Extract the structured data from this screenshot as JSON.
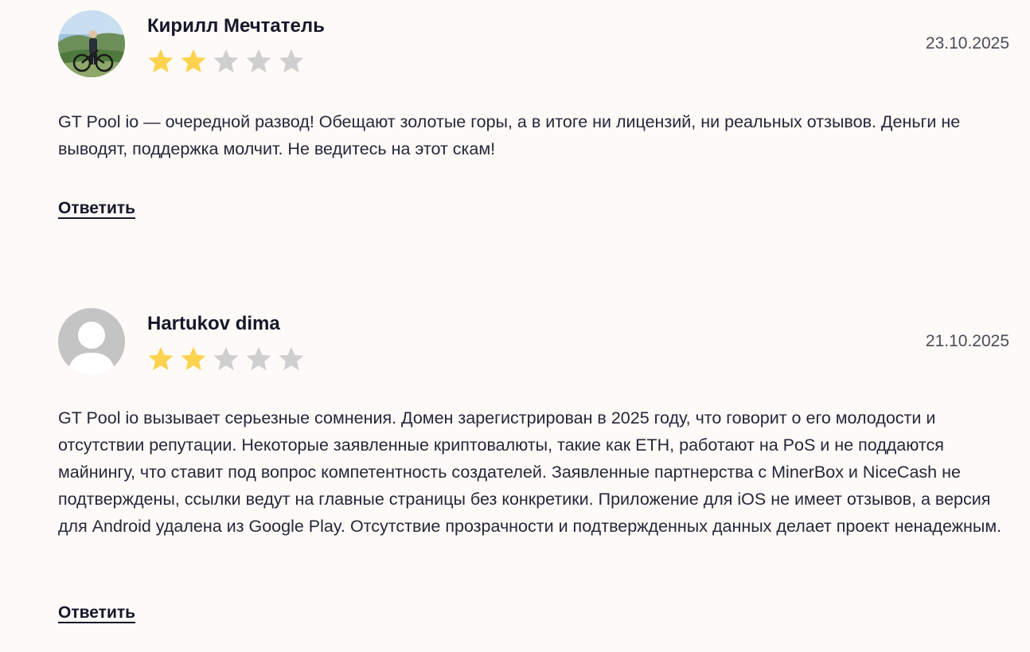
{
  "colors": {
    "background": "#fefaf7",
    "star_filled": "#fdd24f",
    "star_empty": "#cfcfcf",
    "text": "#25273a"
  },
  "reviews": [
    {
      "author": "Кирилл Мечтатель",
      "date": "23.10.2025",
      "rating": 2,
      "max_rating": 5,
      "avatar": "photo-avatar-man-with-bicycle",
      "text": "GT Pool io — очередной развод! Обещают золотые горы, а в итоге ни лицензий, ни реальных отзывов. Деньги не выводят, поддержка молчит. Не ведитесь на этот скам!",
      "reply_label": "Ответить"
    },
    {
      "author": "Hartukov dima",
      "date": "21.10.2025",
      "rating": 2,
      "max_rating": 5,
      "avatar": "default-user-avatar",
      "text": "GT Pool io вызывает серьезные сомнения. Домен зарегистрирован в 2025 году, что говорит о его молодости и отсутствии репутации. Некоторые заявленные криптовалюты, такие как ETH, работают на PoS и не поддаются майнингу, что ставит под вопрос компетентность создателей. Заявленные партнерства с MinerBox и NiceCash не подтверждены, ссылки ведут на главные страницы без конкретики. Приложение для iOS не имеет отзывов, а версия для Android удалена из Google Play. Отсутствие прозрачности и подтвержденных данных делает проект ненадежным.",
      "reply_label": "Ответить"
    }
  ]
}
